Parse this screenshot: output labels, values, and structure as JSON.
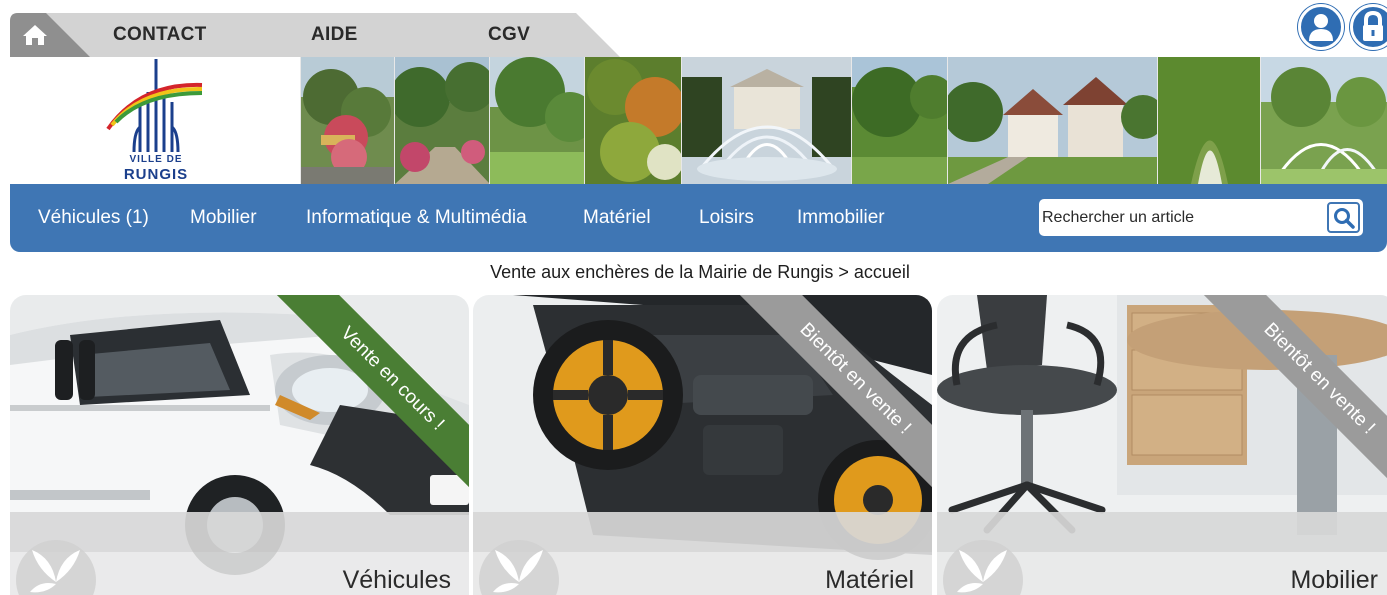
{
  "header": {
    "top_links": [
      "CONTACT",
      "AIDE",
      "CGV"
    ],
    "logo": {
      "line1": "VILLE DE",
      "line2": "RUNGIS"
    }
  },
  "nav": {
    "items": [
      "Véhicules (1)",
      "Mobilier",
      "Informatique & Multimédia",
      "Matériel",
      "Loisirs",
      "Immobilier"
    ],
    "search_placeholder": "Rechercher un article"
  },
  "breadcrumb": "Vente aux enchères de la Mairie de Rungis > accueil",
  "cards": [
    {
      "title": "Véhicules",
      "ribbon": "Vente en cours !",
      "ribbon_color": "#4a7e34"
    },
    {
      "title": "Matériel",
      "ribbon": "Bientôt en vente !",
      "ribbon_color": "#9b9b9b"
    },
    {
      "title": "Mobilier",
      "ribbon": "Bientôt en vente !",
      "ribbon_color": "#9b9b9b"
    }
  ],
  "colors": {
    "nav_blue": "#3f76b4",
    "icon_blue": "#2f6db3",
    "tab_gray": "#d3d3d3",
    "home_tab": "#8f8f8f"
  },
  "icons": {
    "home": "home-icon",
    "account": "user-icon",
    "lock": "lock-icon",
    "search": "search-icon",
    "badge": "leaf-icon"
  }
}
